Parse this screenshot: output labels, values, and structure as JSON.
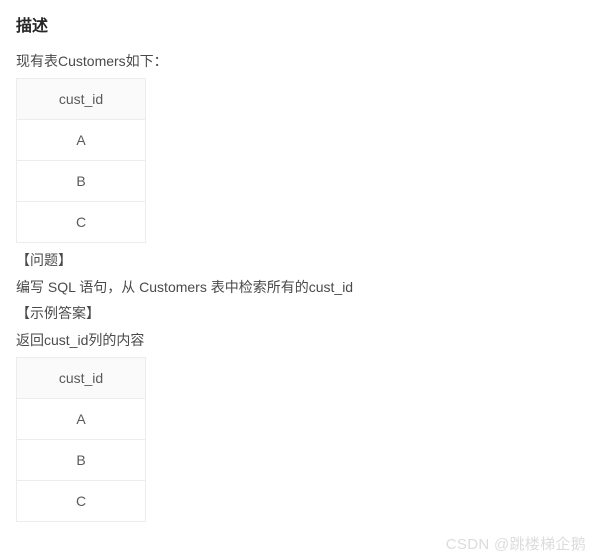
{
  "heading": "描述",
  "intro_line": "现有表Customers如下：",
  "table1": {
    "header": "cust_id",
    "rows": [
      "A",
      "B",
      "C"
    ]
  },
  "question_label": "【问题】",
  "question_text": "编写 SQL 语句，从 Customers 表中检索所有的cust_id",
  "example_label": "【示例答案】",
  "example_text": "返回cust_id列的内容",
  "table2": {
    "header": "cust_id",
    "rows": [
      "A",
      "B",
      "C"
    ]
  },
  "watermark": "CSDN @跳楼梯企鹅"
}
